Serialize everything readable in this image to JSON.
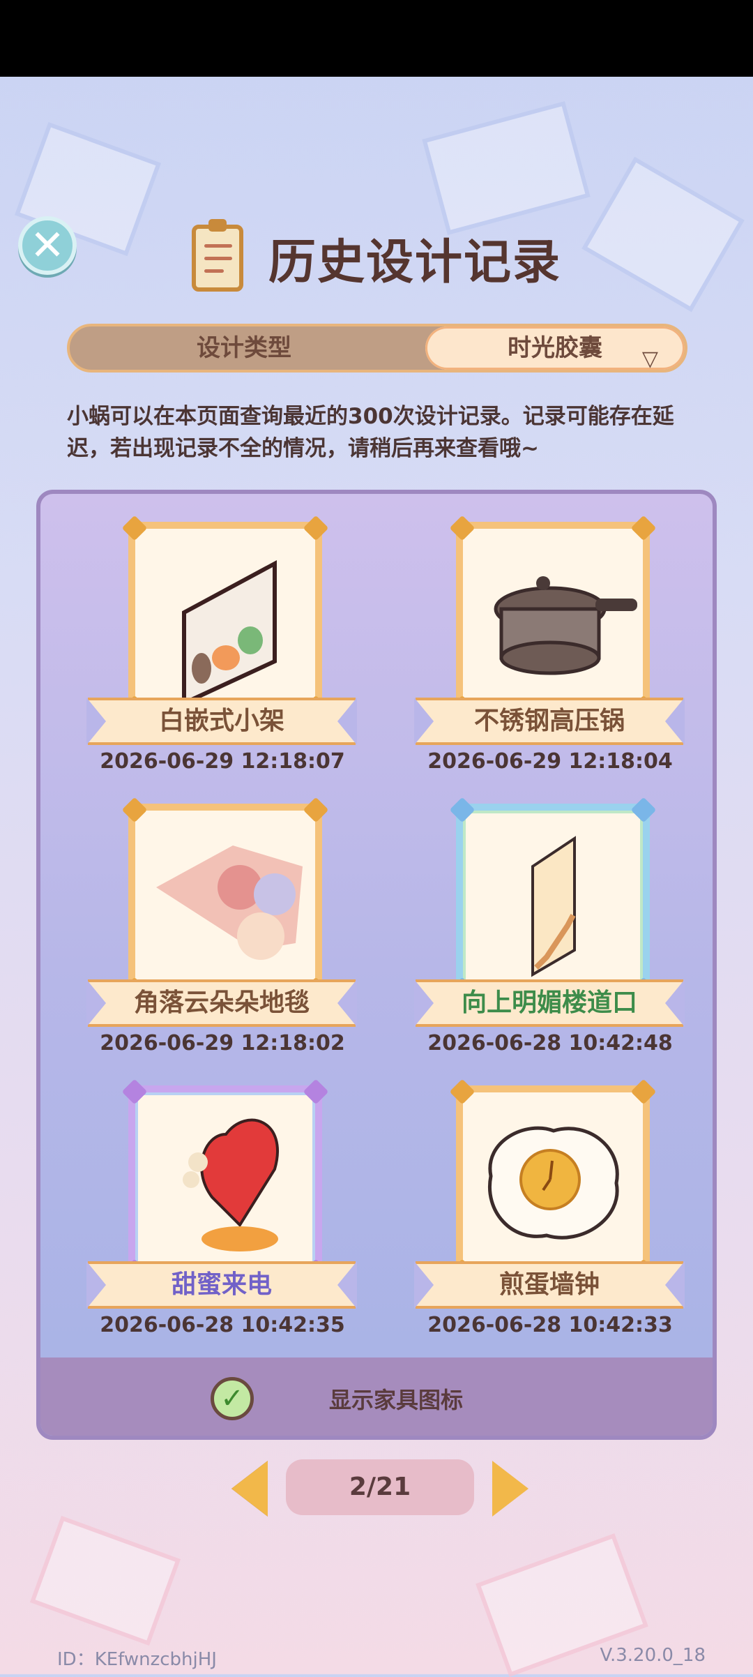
{
  "header": {
    "title": "历史设计记录",
    "close_icon": "close-icon",
    "title_icon": "clipboard-icon"
  },
  "tabs": {
    "left": "设计类型",
    "right": "时光胶囊",
    "right_dropdown_icon": "triangle-down-icon"
  },
  "notice": "小蜗可以在本页面查询最近的300次设计记录。记录可能存在延迟，若出现记录不全的情况，请稍后再来查看哦~",
  "items": [
    {
      "name": "白嵌式小架",
      "date": "2026-06-29 12:18:07",
      "frame": "gold",
      "label_color": "#7a5238"
    },
    {
      "name": "不锈钢高压锅",
      "date": "2026-06-29 12:18:04",
      "frame": "gold",
      "label_color": "#7a5238"
    },
    {
      "name": "角落云朵朵地毯",
      "date": "2026-06-29 12:18:02",
      "frame": "gold",
      "label_color": "#7a5238"
    },
    {
      "name": "向上明媚楼道口",
      "date": "2026-06-28 10:42:48",
      "frame": "blue",
      "label_color": "#3d8c4a"
    },
    {
      "name": "甜蜜来电",
      "date": "2026-06-28 10:42:35",
      "frame": "purple",
      "label_color": "#7161c8"
    },
    {
      "name": "煎蛋墙钟",
      "date": "2026-06-28 10:42:33",
      "frame": "gold",
      "label_color": "#7a5238"
    }
  ],
  "footer": {
    "show_icons_label": "显示家具图标",
    "checkbox_checked": true
  },
  "pager": {
    "label": "2/21",
    "current": 2,
    "total": 21
  },
  "meta": {
    "id_text": "ID：KEfwnzcbhjHJ",
    "version": "V.3.20.0_18"
  }
}
